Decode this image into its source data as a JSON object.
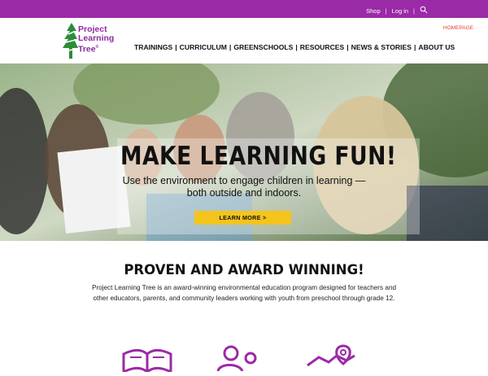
{
  "topbar": {
    "links": [
      {
        "label": "Shop"
      },
      {
        "label": "Log in"
      }
    ],
    "separator": "|",
    "search_icon": "search-icon"
  },
  "header": {
    "logo_lines": [
      "Project",
      "Learning",
      "Tree"
    ],
    "logo_mark": "®",
    "nav": [
      "TRAININGS",
      "CURRICULUM",
      "GREENSCHOOLS",
      "RESOURCES",
      "NEWS & STORIES",
      "ABOUT US"
    ],
    "nav_separator": "|",
    "homepage_label": "HOMEPAGE"
  },
  "hero": {
    "title": "MAKE LEARNING FUN!",
    "subtitle_line1": "Use the environment to engage children in learning —",
    "subtitle_line2": "both outside and indoors.",
    "button": "LEARN MORE  >",
    "button_color": "#f4c41d"
  },
  "section": {
    "title": "PROVEN AND AWARD WINNING!",
    "text": "Project Learning Tree is an award-winning environmental education program designed for teachers and other educators, parents, and community leaders working with youth from preschool through grade 12."
  },
  "colors": {
    "accent": "#9b2aa6",
    "logo": "#8e2a9f",
    "highlight": "#e2422d"
  },
  "icons": [
    "book-icon",
    "people-icon",
    "map-pin-icon"
  ]
}
